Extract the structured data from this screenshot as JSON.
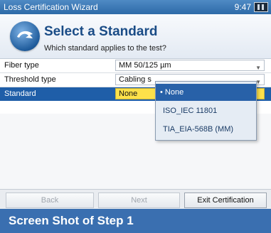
{
  "window": {
    "title": "Loss Certification Wizard",
    "clock": "9:47"
  },
  "header": {
    "title": "Select a Standard",
    "subtitle": "Which standard applies to the test?"
  },
  "form": {
    "fiber_type": {
      "label": "Fiber type",
      "value": "MM 50/125 µm"
    },
    "threshold_type": {
      "label": "Threshold type",
      "value": "Cabling s"
    },
    "standard": {
      "label": "Standard",
      "value": "None"
    }
  },
  "dropdown": {
    "options": [
      "• None",
      "ISO_IEC 11801",
      "TIA_EIA-568B (MM)"
    ],
    "selected_index": 0
  },
  "buttons": {
    "back": "Back",
    "next": "Next",
    "exit": "Exit Certification"
  },
  "caption": "Screen Shot of Step 1",
  "colors": {
    "accent": "#1f5ea8",
    "selection_highlight": "#fde14a",
    "caption_band": "#3a6fb0"
  }
}
